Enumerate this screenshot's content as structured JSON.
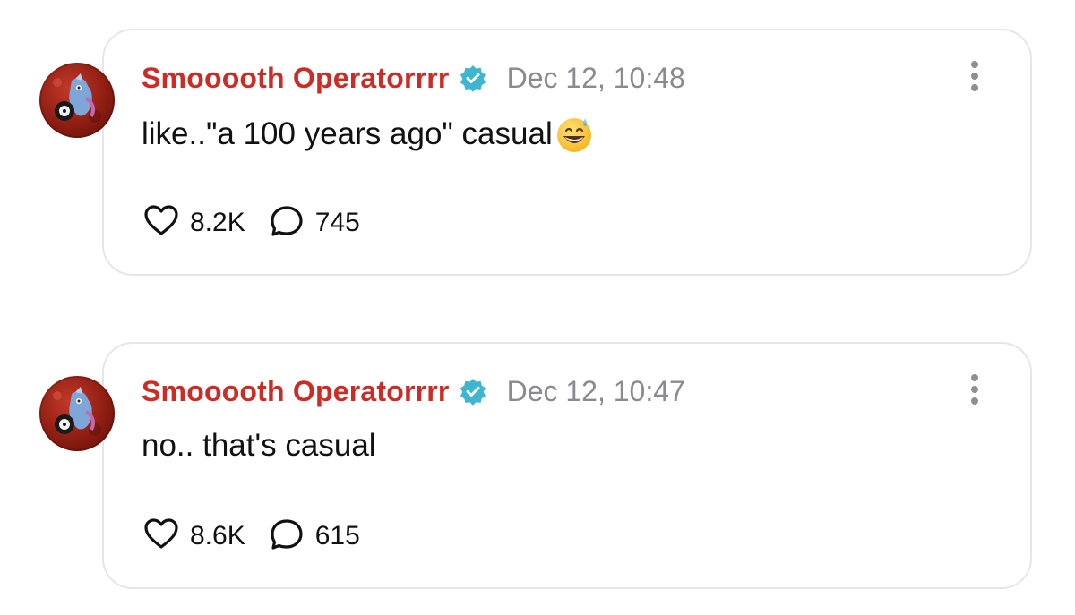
{
  "posts": [
    {
      "username": "Smooooth Operatorrrr",
      "verified_icon": "verified-badge-icon",
      "timestamp": "Dec 12, 10:48",
      "text": "like..\"a 100 years ago\" casual",
      "emoji": "grinning-face-with-sweat",
      "likes": "8.2K",
      "replies": "745"
    },
    {
      "username": "Smooooth Operatorrrr",
      "verified_icon": "verified-badge-icon",
      "timestamp": "Dec 12, 10:47",
      "text": "no.. that's casual",
      "likes": "8.6K",
      "replies": "615"
    }
  ],
  "colors": {
    "username": "#cc2b26",
    "verified": "#3fb6cf",
    "timestamp": "#8a8a90",
    "card_border": "#e6e6ea"
  }
}
